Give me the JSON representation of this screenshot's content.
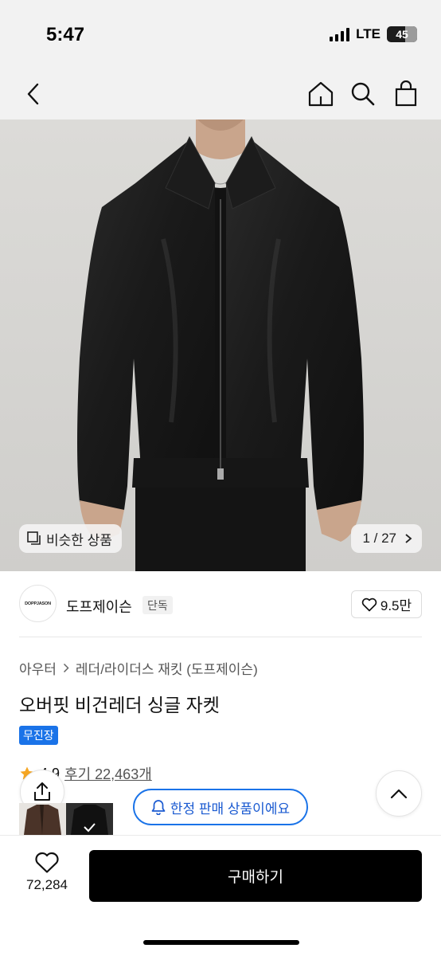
{
  "status_bar": {
    "time": "5:47",
    "network": "LTE",
    "battery": "45"
  },
  "nav": {
    "icons": [
      "back-icon",
      "home-icon",
      "search-icon",
      "bag-icon"
    ]
  },
  "gallery": {
    "similar_label": "비슷한 상품",
    "counter": "1 / 27"
  },
  "brand": {
    "logo_text": "DOPPJASON",
    "name": "도프제이슨",
    "badge": "단독",
    "likes": "9.5만"
  },
  "breadcrumb": {
    "category": "아우터",
    "subcategory": "레더/라이더스 재킷 (도프제이슨)"
  },
  "product": {
    "title": "오버핏 비건레더 싱글 자켓",
    "badge": "무진장"
  },
  "rating": {
    "score": "4.9",
    "reviews": "후기 22,463개"
  },
  "notice": {
    "label": "한정 판매 상품이에요"
  },
  "bottom": {
    "wish_count": "72,284",
    "buy_label": "구매하기"
  },
  "colors": {
    "accent": "#1a73e8",
    "buy_button": "#000000",
    "star": "#f5a623"
  }
}
